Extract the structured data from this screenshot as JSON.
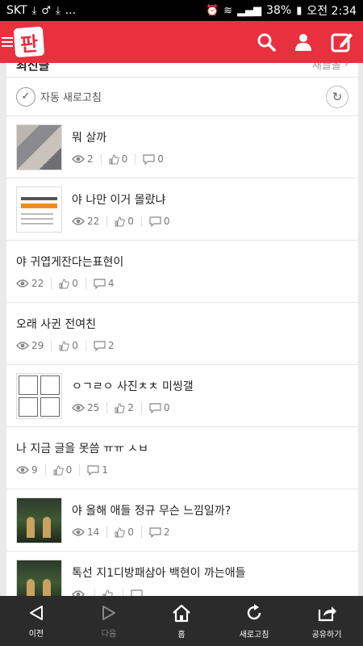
{
  "status_bar": {
    "carrier": "SKT",
    "left_extra": "...",
    "battery": "38%",
    "time": "오전 2:34"
  },
  "header": {
    "logo_text": "판",
    "icons": [
      "search-icon",
      "user-icon",
      "compose-icon"
    ]
  },
  "section": {
    "title": "최신글",
    "more_label": "새글올"
  },
  "auto_refresh": {
    "label": "자동 새로고침"
  },
  "posts": [
    {
      "title": "뭐 살까",
      "views": "2",
      "likes": "0",
      "comments": "0",
      "thumb": "photo"
    },
    {
      "title": "야 나만 이거 몰랐냐",
      "views": "22",
      "likes": "0",
      "comments": "0",
      "thumb": "doc"
    },
    {
      "title": "야 귀엽게잔다는표현이",
      "views": "22",
      "likes": "0",
      "comments": "4",
      "thumb": "none"
    },
    {
      "title": "오래 사귄 전여친",
      "views": "29",
      "likes": "0",
      "comments": "2",
      "thumb": "none"
    },
    {
      "title": "ㅇㄱㄹㅇ 사진ㅊㅊ 미씽갤",
      "views": "25",
      "likes": "2",
      "comments": "0",
      "thumb": "comic"
    },
    {
      "title": "나 지금 글을 못씀 ㅠㅠ ㅅㅂ",
      "views": "9",
      "likes": "0",
      "comments": "1",
      "thumb": "none"
    },
    {
      "title": "야 올해 애들 정규 무슨 느낌일까?",
      "views": "14",
      "likes": "0",
      "comments": "2",
      "thumb": "dark"
    },
    {
      "title": "톡선 지1디방패삼아 백현이 까는애들",
      "views": "",
      "likes": "",
      "comments": "",
      "thumb": "dark"
    }
  ],
  "bottom_nav": {
    "prev": "이전",
    "next": "다음",
    "home": "홈",
    "refresh": "새로고침",
    "share": "공유하기"
  },
  "colors": {
    "brand": "#e8303f",
    "nav_bg": "#2b2b2b"
  }
}
